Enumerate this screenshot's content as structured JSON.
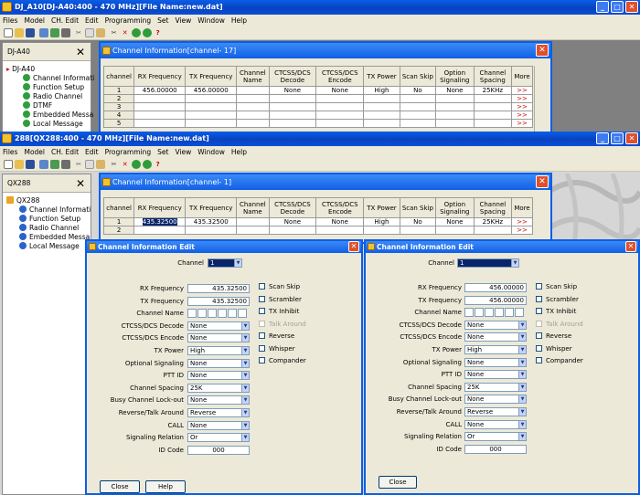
{
  "back_window": {
    "title": "DJ_A10[DJ-A40:400 - 470 MHz][File Name:new.dat]",
    "menu": [
      "Files",
      "Model",
      "CH. Edit",
      "Edit",
      "Programming",
      "Set",
      "View",
      "Window",
      "Help"
    ],
    "tree": {
      "header": "DJ-A40",
      "close": "✕",
      "root": "DJ-A40",
      "items": [
        "Channel Informati",
        "Function Setup",
        "Radio Channel",
        "DTMF",
        "Embedded Messa",
        "Local Message"
      ]
    },
    "chinfo": {
      "title": "Channel Information[channel- 17]",
      "close": "✕",
      "headers": [
        "channel",
        "RX Frequency",
        "TX Frequency",
        "Channel Name",
        "CTCSS/DCS Decode",
        "CTCSS/DCS Encode",
        "TX Power",
        "Scan Skip",
        "Option Signaling",
        "Channel Spacing",
        "More"
      ],
      "rows": [
        [
          "1",
          "456.00000",
          "456.00000",
          "",
          "None",
          "None",
          "High",
          "No",
          "None",
          "25KHz",
          ">>"
        ],
        [
          "2",
          "",
          "",
          "",
          "",
          "",
          "",
          "",
          "",
          "",
          ">>"
        ],
        [
          "3",
          "",
          "",
          "",
          "",
          "",
          "",
          "",
          "",
          "",
          ">>"
        ],
        [
          "4",
          "",
          "",
          "",
          "",
          "",
          "",
          "",
          "",
          "",
          ">>"
        ],
        [
          "5",
          "",
          "",
          "",
          "",
          "",
          "",
          "",
          "",
          "",
          ">>"
        ]
      ]
    }
  },
  "front_window": {
    "title": "288[QX288:400 - 470 MHz][File Name:new.dat]",
    "menu": [
      "Files",
      "Model",
      "CH. Edit",
      "Edit",
      "Programming",
      "Set",
      "View",
      "Window",
      "Help"
    ],
    "tree": {
      "header": "QX288",
      "close": "✕",
      "root": "QX288",
      "items": [
        "Channel Informati",
        "Function Setup",
        "Radio Channel",
        "Embedded Messa",
        "Local Message"
      ]
    },
    "chinfo": {
      "title": "Channel Information[channel- 1]",
      "close": "✕",
      "headers": [
        "channel",
        "RX Frequency",
        "TX Frequency",
        "Channel Name",
        "CTCSS/DCS Decode",
        "CTCSS/DCS Encode",
        "TX Power",
        "Scan Skip",
        "Option Signaling",
        "Channel Spacing",
        "More"
      ],
      "rows": [
        [
          "1",
          "435.32500",
          "435.32500",
          "",
          "None",
          "None",
          "High",
          "No",
          "None",
          "25KHz",
          ">>"
        ],
        [
          "2",
          "",
          "",
          "",
          "",
          "",
          "",
          "",
          "",
          "",
          ">>"
        ]
      ]
    }
  },
  "edit_left": {
    "title": "Channel Information Edit",
    "channel_label": "Channel",
    "channel_value": "1",
    "labels": [
      "RX Frequency",
      "TX Frequency",
      "Channel Name",
      "CTCSS/DCS Decode",
      "CTCSS/DCS Encode",
      "TX Power",
      "Optional Signaling",
      "PTT ID",
      "Channel Spacing",
      "Busy Channel Lock-out",
      "Reverse/Talk Around",
      "CALL",
      "Signaling Relation",
      "ID Code"
    ],
    "values": [
      "435.32500",
      "435.32500",
      "",
      "None",
      "None",
      "High",
      "None",
      "None",
      "25K",
      "None",
      "Reverse",
      "None",
      "Or",
      "000"
    ],
    "checks": [
      "Scan Skip",
      "Scrambler",
      "TX Inhibit",
      "Talk Around",
      "Reverse",
      "Whisper",
      "Compander"
    ],
    "close": "Close",
    "help": "Help"
  },
  "edit_right": {
    "title": "Channel Information Edit",
    "channel_label": "Channel",
    "channel_value": "1",
    "labels": [
      "RX Frequency",
      "TX Frequency",
      "Channel Name",
      "CTCSS/DCS Decode",
      "CTCSS/DCS Encode",
      "TX Power",
      "Optional Signaling",
      "PTT ID",
      "Channel Spacing",
      "Busy Channel Lock-out",
      "Reverse/Talk Around",
      "CALL",
      "Signaling Relation",
      "ID Code"
    ],
    "values": [
      "456.00000",
      "456.00000",
      "",
      "None",
      "None",
      "High",
      "None",
      "None",
      "25K",
      "None",
      "Reverse",
      "None",
      "Or",
      "000"
    ],
    "checks": [
      "Scan Skip",
      "Scrambler",
      "TX Inhibit",
      "Talk Around",
      "Reverse",
      "Whisper",
      "Compander"
    ],
    "close": "Close"
  },
  "colors": {
    "xp_title": "#0a4fd6",
    "face": "#ece9d8",
    "close_red": "#e0502c",
    "selection": "#0a246a",
    "more_arrow": "#cc0000"
  },
  "icons": {
    "win_min": "_",
    "win_max": "□",
    "win_close": "✕",
    "dropdown": "▼"
  }
}
